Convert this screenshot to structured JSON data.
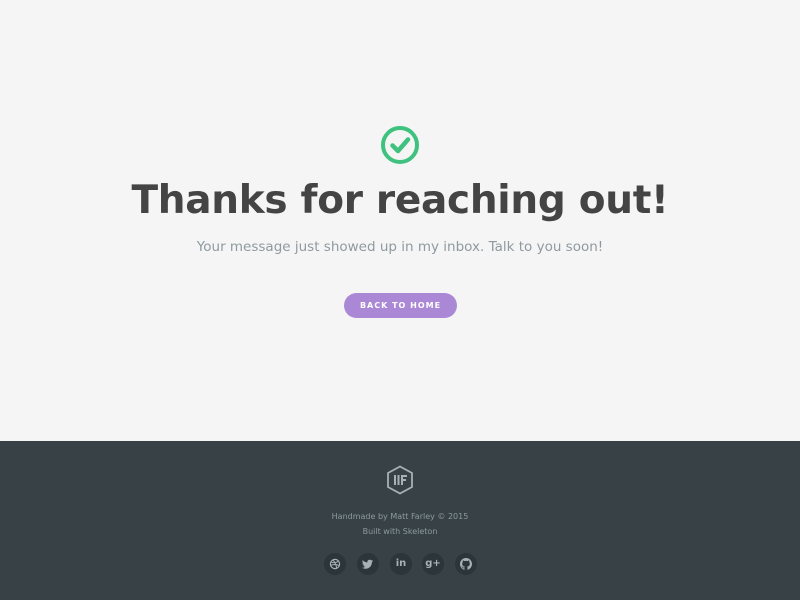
{
  "hero": {
    "title": "Thanks for reaching out!",
    "subtitle": "Your message just showed up in my inbox. Talk to you soon!",
    "button_label": "BACK TO HOME",
    "success_icon": "check-circle-icon"
  },
  "footer": {
    "logo": "mf-hexagon-logo",
    "credit": "Handmade by Matt Farley © 2015",
    "built_with": "Built with Skeleton",
    "social": [
      {
        "name": "dribbble",
        "icon": "dribbble-icon"
      },
      {
        "name": "twitter",
        "icon": "twitter-icon"
      },
      {
        "name": "linkedin",
        "icon": "linkedin-icon",
        "glyph": "in"
      },
      {
        "name": "google-plus",
        "icon": "google-plus-icon",
        "glyph": "g+"
      },
      {
        "name": "github",
        "icon": "github-icon"
      }
    ]
  },
  "colors": {
    "background": "#f5f5f5",
    "title": "#444444",
    "subtitle": "#8e9aa0",
    "success": "#3fc27f",
    "button": "#aa88d6",
    "footer": "#374146"
  }
}
